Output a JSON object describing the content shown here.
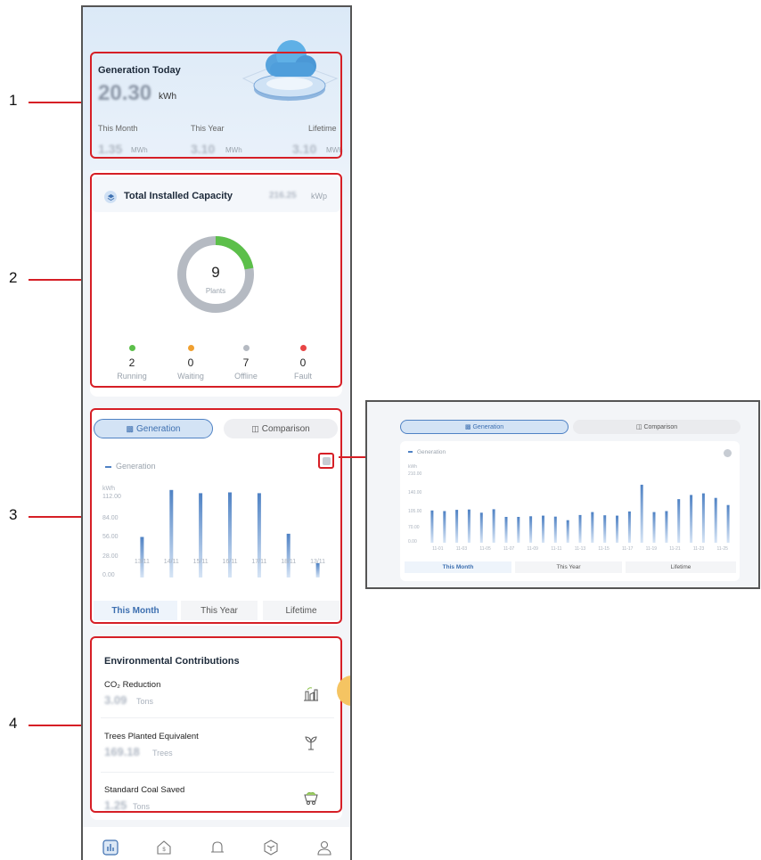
{
  "annotations": [
    "1",
    "2",
    "3",
    "4"
  ],
  "summary": {
    "title": "Generation Today",
    "today_value": "20.30",
    "today_unit": "kWh",
    "columns": [
      {
        "label": "This Month",
        "value": "1.35",
        "unit": "MWh"
      },
      {
        "label": "This Year",
        "value": "3.10",
        "unit": "MWh"
      },
      {
        "label": "Lifetime",
        "value": "3.10",
        "unit": "MWh"
      }
    ]
  },
  "capacity": {
    "title": "Total Installed Capacity",
    "value": "216.25",
    "unit": "kWp",
    "plants_count": "9",
    "plants_label": "Plants",
    "statuses": [
      {
        "count": "2",
        "label": "Running",
        "color": "#5cbf4a"
      },
      {
        "count": "0",
        "label": "Waiting",
        "color": "#f0a030"
      },
      {
        "count": "7",
        "label": "Offline",
        "color": "#b5bac2"
      },
      {
        "count": "0",
        "label": "Fault",
        "color": "#e84545"
      }
    ],
    "ring_fraction": 0.2222,
    "colors": {
      "running": "#5cbf4a",
      "offline": "#b5bac2"
    }
  },
  "generation": {
    "tabs": [
      "Generation",
      "Comparison"
    ],
    "legend": "Generation",
    "periods": [
      "This Month",
      "This Year",
      "Lifetime"
    ],
    "accent": "#4f82c4"
  },
  "chart_data": [
    {
      "type": "bar",
      "title": "",
      "ylabel": "kWh",
      "series": [
        {
          "name": "Generation",
          "values": [
            51,
            110,
            106,
            107,
            106,
            55,
            18
          ]
        }
      ],
      "categories": [
        "13/11",
        "14/11",
        "15/11",
        "16/11",
        "17/11",
        "18/11",
        "13/11"
      ],
      "yticks": [
        "112.00",
        "84.00",
        "56.00",
        "28.00",
        "0.00"
      ],
      "ylim": [
        0,
        112
      ],
      "grid": false
    },
    {
      "type": "bar",
      "title": "",
      "ylabel": "kWh",
      "series": [
        {
          "name": "Generation",
          "values": [
            100,
            98,
            102,
            103,
            93,
            104,
            80,
            80,
            82,
            84,
            81,
            70,
            86,
            95,
            85,
            84,
            97,
            180,
            95,
            98,
            135,
            148,
            153,
            139,
            117
          ]
        }
      ],
      "categories": [
        "11-01",
        "11-03",
        "11-05",
        "11-07",
        "11-09",
        "11-11",
        "11-13",
        "11-15",
        "11-17",
        "11-19",
        "11-21",
        "11-23",
        "11-25"
      ],
      "yticks": [
        "210.00",
        "140.00",
        "105.00",
        "70.00",
        "0.00"
      ],
      "ylim": [
        0,
        210
      ],
      "grid": false
    }
  ],
  "zoom": {
    "tabs": [
      "Generation",
      "Comparison"
    ],
    "legend": "Generation",
    "unit": "kWh",
    "periods": [
      "This Month",
      "This Year",
      "Lifetime"
    ]
  },
  "environment": {
    "title": "Environmental Contributions",
    "items": [
      {
        "label": "CO₂ Reduction",
        "value": "3.09",
        "unit": "Tons",
        "icon": "factory-icon"
      },
      {
        "label": "Trees Planted Equivalent",
        "value": "169.18",
        "unit": "Trees",
        "icon": "sprout-icon"
      },
      {
        "label": "Standard Coal Saved",
        "value": "1.25",
        "unit": "Tons",
        "icon": "coal-cart-icon"
      }
    ]
  },
  "nav_icons": [
    "chart-icon",
    "plant-icon",
    "alarm-icon",
    "device-icon",
    "profile-icon"
  ]
}
